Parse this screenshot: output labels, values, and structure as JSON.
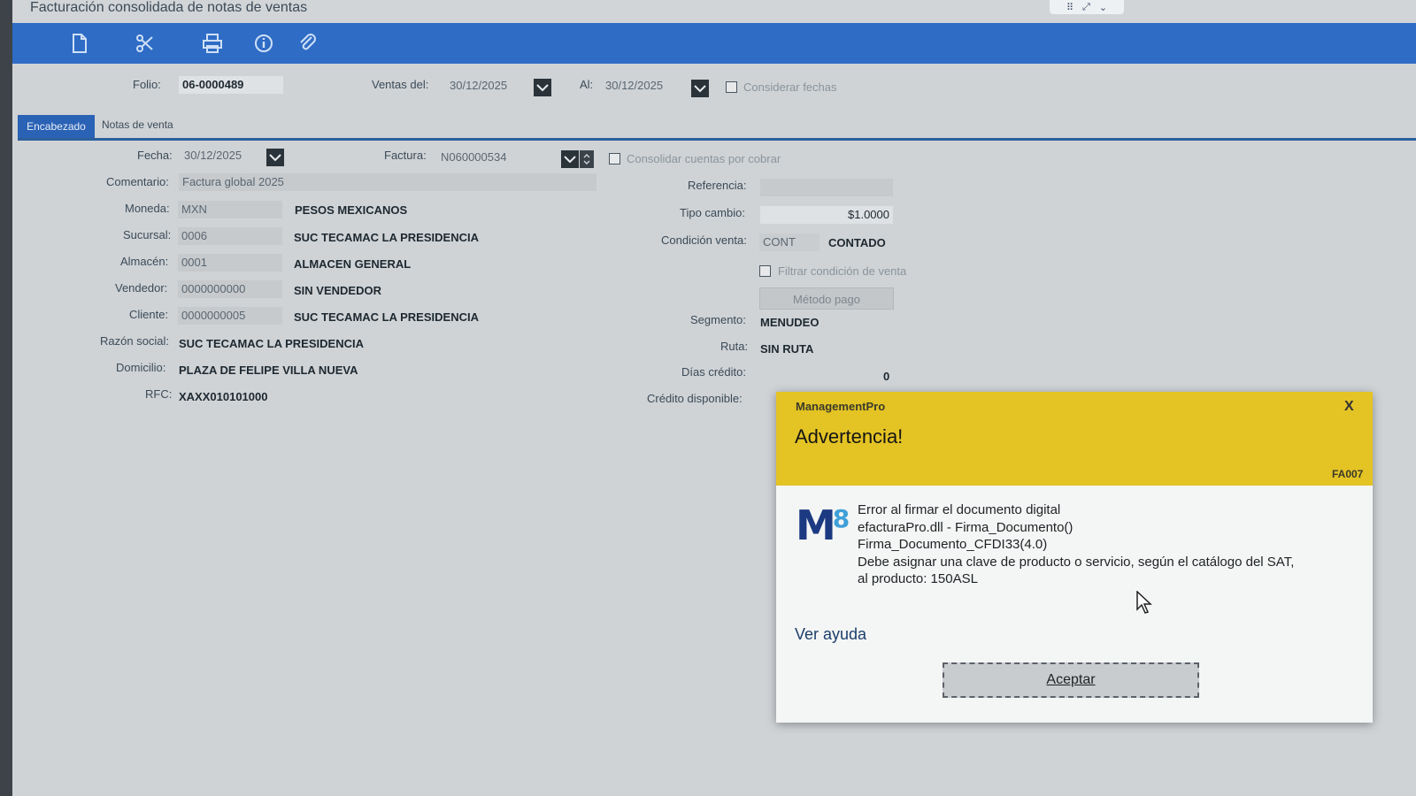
{
  "window": {
    "title": "Facturación consolidada de notas de ventas",
    "controls": [
      "⠿",
      "⤢",
      "⌄"
    ]
  },
  "toolbar": {
    "icons": [
      "new-document-icon",
      "scissors-icon",
      "print-icon",
      "info-icon",
      "attach-icon"
    ]
  },
  "filter": {
    "folio_label": "Folio:",
    "folio_value": "06-0000489",
    "ventas_del_label": "Ventas del:",
    "ventas_del_value": "30/12/2025",
    "al_label": "Al:",
    "al_value": "30/12/2025",
    "considerar_fechas": "Considerar fechas"
  },
  "tabs": {
    "encabezado": "Encabezado",
    "notas": "Notas de venta"
  },
  "form": {
    "fecha_label": "Fecha:",
    "fecha_value": "30/12/2025",
    "factura_label": "Factura:",
    "factura_value": "N060000534",
    "consolidar_label": "Consolidar cuentas por cobrar",
    "comentario_label": "Comentario:",
    "comentario_value": "Factura global 2025",
    "moneda_label": "Moneda:",
    "moneda_code": "MXN",
    "moneda_name": "PESOS MEXICANOS",
    "sucursal_label": "Sucursal:",
    "sucursal_code": "0006",
    "sucursal_name": "SUC TECAMAC LA PRESIDENCIA",
    "almacen_label": "Almacén:",
    "almacen_code": "0001",
    "almacen_name": "ALMACEN GENERAL",
    "vendedor_label": "Vendedor:",
    "vendedor_code": "0000000000",
    "vendedor_name": "SIN VENDEDOR",
    "cliente_label": "Cliente:",
    "cliente_code": "0000000005",
    "cliente_name": "SUC TECAMAC LA PRESIDENCIA",
    "razon_label": "Razón social:",
    "razon_value": "SUC TECAMAC LA PRESIDENCIA",
    "domicilio_label": "Domicilio:",
    "domicilio_value": "PLAZA DE FELIPE VILLA NUEVA",
    "rfc_label": "RFC:",
    "rfc_value": "XAXX010101000",
    "referencia_label": "Referencia:",
    "referencia_value": "",
    "tipo_cambio_label": "Tipo cambio:",
    "tipo_cambio_value": "$1.0000",
    "condicion_label": "Condición venta:",
    "condicion_code": "CONT",
    "condicion_name": "CONTADO",
    "filtrar_label": "Filtrar condición de venta",
    "metodo_pago": "Método pago",
    "segmento_label": "Segmento:",
    "segmento_value": "MENUDEO",
    "ruta_label": "Ruta:",
    "ruta_value": "SIN RUTA",
    "dias_label": "Días crédito:",
    "dias_value": "0",
    "credito_label": "Crédito disponible:"
  },
  "dialog": {
    "app": "ManagementPro",
    "title": "Advertencia!",
    "close": "X",
    "code": "FA007",
    "logo": "M",
    "logo_sub": "8",
    "lines": [
      "Error al firmar el documento digital",
      "efacturaPro.dll - Firma_Documento()",
      "Firma_Documento_CFDI33(4.0)",
      "Debe asignar una clave de producto o servicio, según el catálogo del SAT,",
      "al producto: 150ASL"
    ],
    "help": "Ver ayuda",
    "ok": "Aceptar"
  }
}
